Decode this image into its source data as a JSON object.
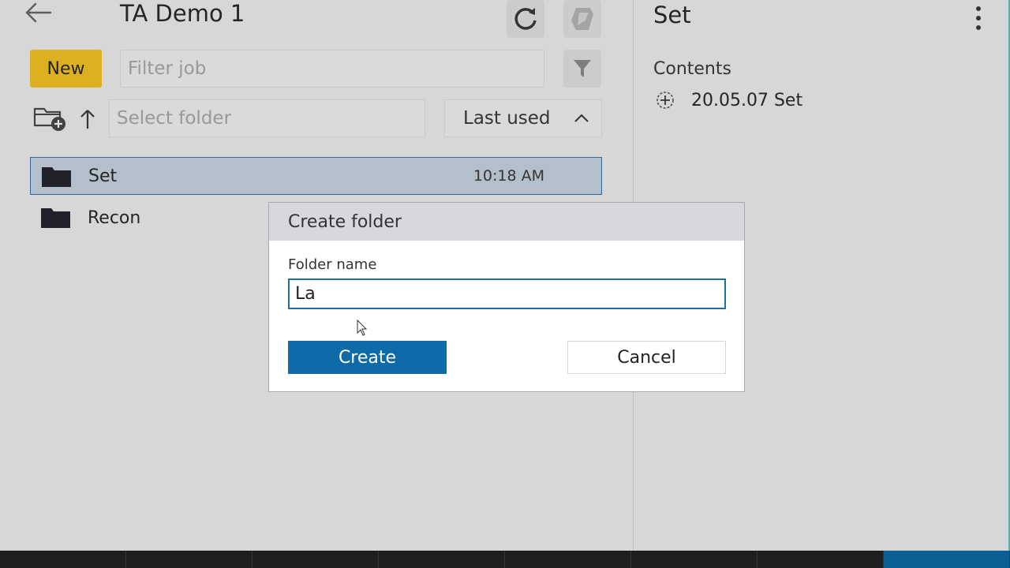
{
  "header": {
    "title": "TA Demo 1"
  },
  "toolbar": {
    "new_label": "New",
    "filter_placeholder": "Filter job"
  },
  "folder_bar": {
    "select_placeholder": "Select folder",
    "sort_label": "Last used"
  },
  "jobs": [
    {
      "name": "Set",
      "time": "10:18 AM",
      "selected": true
    },
    {
      "name": "Recon",
      "time": "",
      "selected": false
    }
  ],
  "details": {
    "title": "Set",
    "contents_label": "Contents",
    "items": [
      {
        "name": "20.05.07 Set"
      }
    ]
  },
  "dialog": {
    "title": "Create folder",
    "field_label": "Folder name",
    "field_value": "La",
    "create_label": "Create",
    "cancel_label": "Cancel"
  },
  "colors": {
    "accent_yellow": "#f8c51d",
    "primary_blue": "#0f6aa8",
    "selection": "#c8d6e3"
  }
}
